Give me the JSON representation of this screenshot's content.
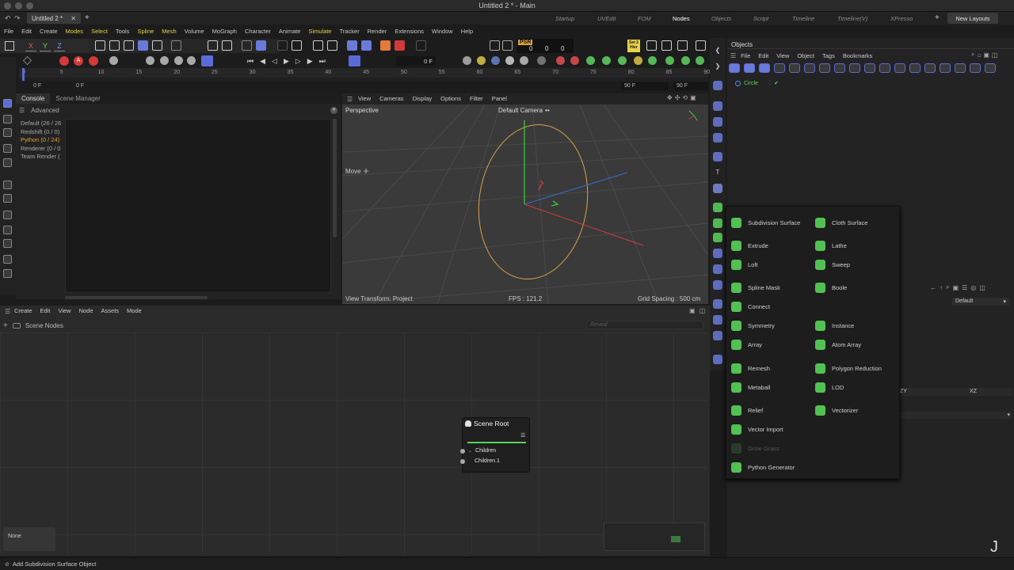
{
  "window": {
    "title": "Untitled 2 * - Main"
  },
  "tabs": {
    "doc": "Untitled 2 *"
  },
  "layouts": [
    "Startup",
    "UVEdit",
    "FOM",
    "Nodes",
    "Objects",
    "Script",
    "Timeline",
    "Timeline(V)",
    "XPresso"
  ],
  "layout_active": "Nodes",
  "new_layouts": "New Layouts",
  "menu": [
    "File",
    "Edit",
    "Create",
    "Modes",
    "Select",
    "Tools",
    "Spline",
    "Mesh",
    "Volume",
    "MoGraph",
    "Character",
    "Animate",
    "Simulate",
    "Tracker",
    "Render",
    "Extensions",
    "Window",
    "Help"
  ],
  "menu_highlight": [
    "Modes",
    "Select",
    "Spline",
    "Mesh",
    "Simulate"
  ],
  "xyz": [
    "X",
    "Y",
    "Z"
  ],
  "transport": {
    "frame_field": "0 F"
  },
  "timeline": {
    "ticks": [
      "0",
      "5",
      "10",
      "15",
      "20",
      "25",
      "30",
      "35",
      "40",
      "45",
      "50",
      "55",
      "60",
      "65",
      "70",
      "75",
      "80",
      "85",
      "90"
    ],
    "start": "0 F",
    "start2": "0 F",
    "end": "90 F",
    "end2": "90 F"
  },
  "psr": "PSR",
  "psr_vals": [
    "0",
    "0",
    "0"
  ],
  "set2hier": "Set 2 Hier",
  "console": {
    "tabs": [
      "Console",
      "Scene Manager"
    ],
    "advanced": "Advanced",
    "items": [
      "Default (26 / 26",
      "Redshift (0 / 0)",
      "Python (0 / 24)",
      "Renderer (0 / 0",
      "Team Render  ("
    ]
  },
  "viewport": {
    "menu": [
      "View",
      "Cameras",
      "Display",
      "Options",
      "Filter",
      "Panel"
    ],
    "label": "Perspective",
    "camera": "Default Camera",
    "camera_suffix": "••",
    "move": "Move",
    "move_suffix": "✛",
    "view_transform": "View Transform: Project",
    "fps": "FPS : 121.2",
    "grid": "Grid Spacing : 500 cm"
  },
  "nodes": {
    "menu": [
      "Create",
      "Edit",
      "View",
      "Node",
      "Assets",
      "Mode"
    ],
    "scene_nodes": "Scene Nodes",
    "reveal": "Reveal",
    "node_title": "Scene Root",
    "node_rows": [
      "Children",
      "Children.1"
    ],
    "none": "None"
  },
  "objects": {
    "title": "Objects",
    "menu": [
      "File",
      "Edit",
      "View",
      "Object",
      "Tags",
      "Bookmarks"
    ],
    "item": "Circle"
  },
  "attributes": {
    "mode": "Default",
    "zy": "ZY",
    "xz": "XZ"
  },
  "popup": {
    "items": [
      {
        "label": "Subdivision Surface",
        "icon": "subdivision-surface-icon"
      },
      {
        "label": "Cloth Surface",
        "icon": "cloth-surface-icon"
      },
      {
        "label": "Extrude",
        "icon": "extrude-icon"
      },
      {
        "label": "Lathe",
        "icon": "lathe-icon"
      },
      {
        "label": "Loft",
        "icon": "loft-icon"
      },
      {
        "label": "Sweep",
        "icon": "sweep-icon"
      },
      {
        "label": "Spline Mask",
        "icon": "spline-mask-icon"
      },
      {
        "label": "Boole",
        "icon": "boole-icon"
      },
      {
        "label": "Connect",
        "icon": "connect-icon"
      },
      {
        "label": "Symmetry",
        "icon": "symmetry-icon"
      },
      {
        "label": "Instance",
        "icon": "instance-icon"
      },
      {
        "label": "Array",
        "icon": "array-icon"
      },
      {
        "label": "Atom Array",
        "icon": "atom-array-icon"
      },
      {
        "label": "Remesh",
        "icon": "remesh-icon"
      },
      {
        "label": "Polygon Reduction",
        "icon": "polygon-reduction-icon"
      },
      {
        "label": "Metaball",
        "icon": "metaball-icon"
      },
      {
        "label": "LOD",
        "icon": "lod-icon"
      },
      {
        "label": "Relief",
        "icon": "relief-icon"
      },
      {
        "label": "Vectorizer",
        "icon": "vectorizer-icon"
      },
      {
        "label": "Vector Import",
        "icon": "vector-import-icon"
      },
      {
        "label": "Grow Grass",
        "icon": "grow-grass-icon",
        "disabled": true
      },
      {
        "label": "Python Generator",
        "icon": "python-generator-icon"
      }
    ]
  },
  "status": "Add Subdivision Surface Object",
  "colors": {
    "accent_green": "#5ad35a",
    "highlight_yellow": "#e8d24a",
    "python_orange": "#e2a23a",
    "spline_orange": "#d9a24a",
    "axis_red": "#d23a3a",
    "axis_green": "#3ad23a",
    "axis_blue": "#3a6ad2"
  }
}
